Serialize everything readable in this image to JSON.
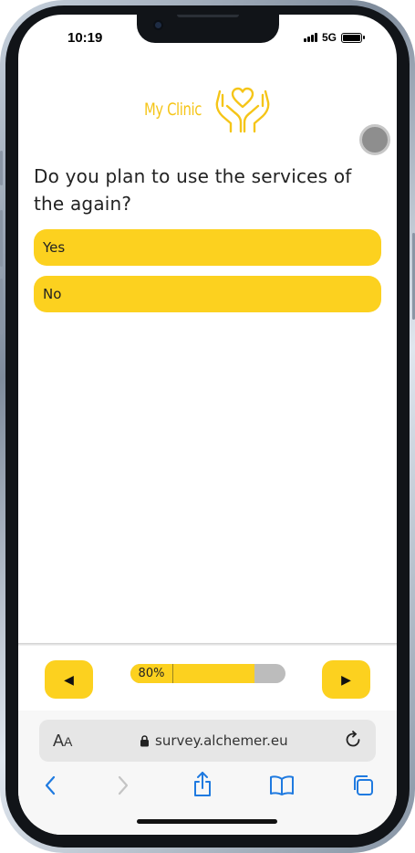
{
  "status_bar": {
    "time": "10:19",
    "network": "5G"
  },
  "logo": {
    "text": "My Clinic",
    "icon": "hands-heart-icon",
    "color": "#f5c518"
  },
  "question": {
    "text": "Do you plan to use the services of the again?"
  },
  "options": [
    {
      "label": "Yes"
    },
    {
      "label": "No"
    }
  ],
  "footer": {
    "prev_icon": "triangle-left-icon",
    "next_icon": "triangle-right-icon",
    "prev_glyph": "◀",
    "next_glyph": "▶",
    "progress_label": "80%",
    "progress_value": 0.8
  },
  "browser": {
    "text_size_label_large": "A",
    "text_size_label_small": "A",
    "url": "survey.alchemer.eu"
  },
  "colors": {
    "accent": "#fcd11f",
    "progress_track": "#bcbcbc",
    "ios_blue": "#1f7ae0"
  }
}
